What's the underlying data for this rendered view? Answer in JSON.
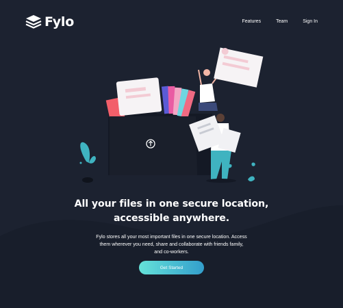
{
  "brand": {
    "name": "Fylo",
    "icon": "stacked-layers-icon"
  },
  "nav": {
    "items": [
      {
        "label": "Features"
      },
      {
        "label": "Team"
      },
      {
        "label": "Sign In"
      }
    ]
  },
  "hero": {
    "title_lines": [
      "All your files in one secure location,",
      "accessible anywhere."
    ],
    "description_lines": [
      "Fylo stores all your most important files in one secure location. Access",
      "them wherever you need, share and collaborate with friends family,",
      "and co-workers."
    ],
    "cta_label": "Get Started",
    "illustration": {
      "upload_icon": "upload-arrow-icon"
    }
  },
  "colors": {
    "background": "#1c2230",
    "curve": "#181e2b",
    "cta_start": "#65e2d9",
    "cta_end": "#339ecc",
    "folder": "#1a1f2b"
  }
}
